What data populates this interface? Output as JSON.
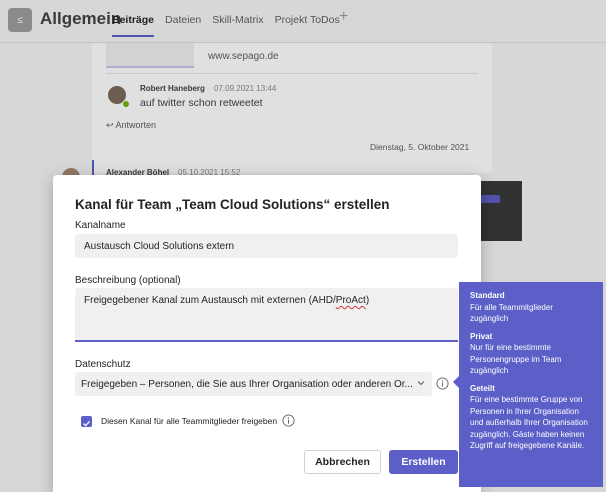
{
  "header": {
    "team_avatar_text": "≤",
    "channel_name": "Allgemein",
    "tabs": [
      "Beiträge",
      "Dateien",
      "Skill-Matrix",
      "Projekt ToDos"
    ],
    "add_tab_symbol": "+"
  },
  "chat": {
    "link_url": "www.sepago.de",
    "reply": {
      "author": "Robert Haneberg",
      "timestamp": "07.09.2021 13:44",
      "text": "auf twitter schon retweetet"
    },
    "reply_link": "↩ Antworten",
    "date_separator": "Dienstag, 5. Oktober 2021",
    "message2": {
      "author": "Alexander Böhel",
      "timestamp": "05.10.2021 15:52"
    }
  },
  "dialog": {
    "title": "Kanal für Team „Team Cloud Solutions“ erstellen",
    "name_label": "Kanalname",
    "name_value": "Austausch Cloud Solutions extern",
    "description_label": "Beschreibung (optional)",
    "description_prefix": "Freigegebener Kanal zum Austausch mit externen (AHD/",
    "description_misspelled": "ProAct",
    "description_suffix": ")",
    "privacy_label": "Datenschutz",
    "privacy_value": "Freigegeben – Personen, die Sie aus Ihrer Organisation oder anderen Or...",
    "checkbox_label": "Diesen Kanal für alle Teammitglieder freigeben",
    "checkbox_checked": true,
    "cancel_label": "Abbrechen",
    "create_label": "Erstellen"
  },
  "tooltip": {
    "standard_title": "Standard",
    "standard_text": "Für alle Teammitglieder zugänglich",
    "private_title": "Privat",
    "private_text": "Nur für eine bestimmte Personengruppe im Team zugänglich",
    "shared_title": "Geteilt",
    "shared_text": "Für eine bestimmte Gruppe von Personen in Ihrer Organisation und außerhalb Ihrer Organisation zugänglich. Gäste haben keinen Zugriff auf freigegebene Kanäle."
  },
  "colors": {
    "accent": "#5b5fc7",
    "spellcheck": "#d13438",
    "presence_available": "#6bb700"
  }
}
